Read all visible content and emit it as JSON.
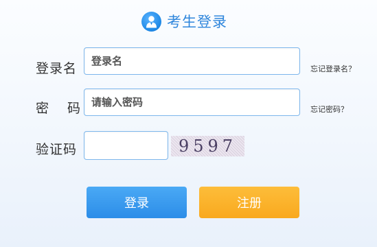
{
  "header": {
    "icon": "user-icon",
    "title": "考生登录"
  },
  "form": {
    "username": {
      "label": "登录名",
      "placeholder": "登录名",
      "help": "忘记登录名？"
    },
    "password": {
      "label": "密　码",
      "placeholder": "请输入密码",
      "help": "忘记密码？"
    },
    "captcha": {
      "label": "验证码",
      "value": "",
      "image_text": "9597"
    }
  },
  "actions": {
    "login_label": "登录",
    "register_label": "注册"
  },
  "colors": {
    "accent_blue": "#2f86dc",
    "login_button": "#2c8de8",
    "register_button": "#f9a91e",
    "input_border": "#7cb6ec"
  }
}
